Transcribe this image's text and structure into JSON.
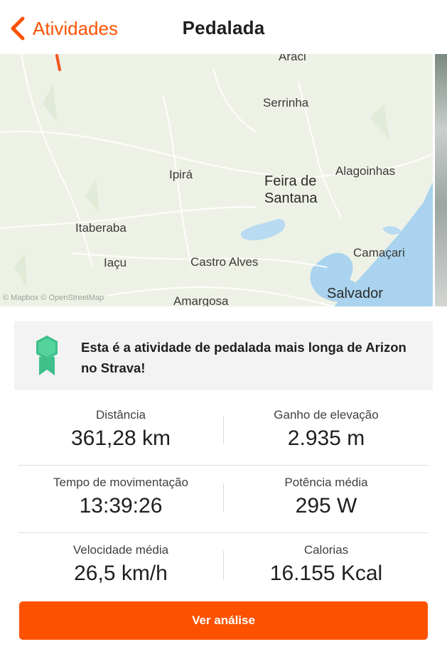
{
  "header": {
    "back_label": "Atividades",
    "title": "Pedalada"
  },
  "map": {
    "labels": {
      "araci": "Araci",
      "serrinha": "Serrinha",
      "ipira": "Ipirá",
      "feira": "Feira de",
      "santana": "Santana",
      "alagoinhas": "Alagoinhas",
      "itaberaba": "Itaberaba",
      "iacu": "Iaçu",
      "castro_alves": "Castro Alves",
      "camacari": "Camaçari",
      "salvador": "Salvador",
      "amargosa": "Amargosa"
    },
    "attribution": "© Mapbox © OpenStreetMap"
  },
  "achievement": {
    "text": "Esta é a atividade de pedalada mais longa de Arizon no Strava!"
  },
  "stats": [
    {
      "left": {
        "label": "Distância",
        "value": "361,28 km"
      },
      "right": {
        "label": "Ganho de elevação",
        "value": "2.935 m"
      }
    },
    {
      "left": {
        "label": "Tempo de movimentação",
        "value": "13:39:26"
      },
      "right": {
        "label": "Potência média",
        "value": "295 W"
      }
    },
    {
      "left": {
        "label": "Velocidade média",
        "value": "26,5 km/h"
      },
      "right": {
        "label": "Calorias",
        "value": "16.155 Kcal"
      }
    }
  ],
  "cta_label": "Ver análise",
  "colors": {
    "accent": "#fc5200",
    "route": "#f05a22",
    "water": "#a9d3ee",
    "map_bg": "#eef2e6"
  }
}
